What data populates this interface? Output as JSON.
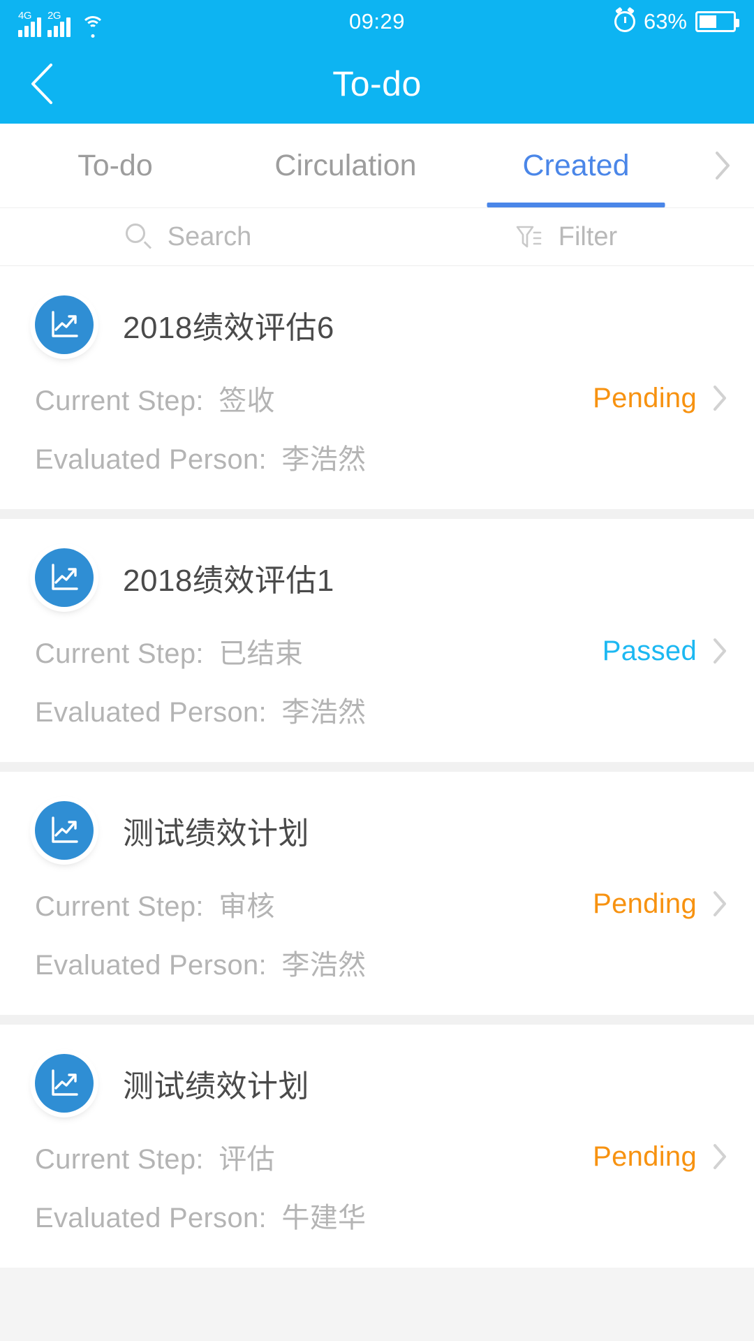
{
  "status_bar": {
    "network_primary": "4G",
    "network_secondary": "2G",
    "wifi_icon": "wifi-icon",
    "time": "09:29",
    "alarm_icon": "alarm-icon",
    "battery_percent": "63%",
    "battery_level": 52
  },
  "nav": {
    "back_icon": "chevron-left-icon",
    "title": "To-do"
  },
  "tabs": {
    "items": [
      {
        "label": "To-do",
        "active": false
      },
      {
        "label": "Circulation",
        "active": false
      },
      {
        "label": "Created",
        "active": true
      }
    ],
    "more_icon": "chevron-right-icon",
    "active_color": "#4a86e8",
    "inactive_color": "#9d9d9d"
  },
  "toolbar": {
    "search_label": "Search",
    "search_icon": "search-icon",
    "filter_label": "Filter",
    "filter_icon": "filter-icon"
  },
  "labels": {
    "current_step": "Current Step:",
    "evaluated_person": "Evaluated Person:"
  },
  "colors": {
    "header_blue": "#0db4f2",
    "avatar_blue": "#2f8ed4",
    "pending_orange": "#f79210",
    "passed_blue": "#1cb8f2",
    "meta_gray": "#b4b4b4",
    "title_gray": "#4a4a4a"
  },
  "list": {
    "items": [
      {
        "icon": "chart-trend-up-icon",
        "title": "2018绩效评估6",
        "current_step": "签收",
        "evaluated_person": "李浩然",
        "status": "Pending",
        "status_type": "pending",
        "chevron_icon": "chevron-right-icon"
      },
      {
        "icon": "chart-trend-up-icon",
        "title": "2018绩效评估1",
        "current_step": "已结束",
        "evaluated_person": "李浩然",
        "status": "Passed",
        "status_type": "passed",
        "chevron_icon": "chevron-right-icon"
      },
      {
        "icon": "chart-trend-up-icon",
        "title": "测试绩效计划",
        "current_step": "审核",
        "evaluated_person": "李浩然",
        "status": "Pending",
        "status_type": "pending",
        "chevron_icon": "chevron-right-icon"
      },
      {
        "icon": "chart-trend-up-icon",
        "title": "测试绩效计划",
        "current_step": "评估",
        "evaluated_person": "牛建华",
        "status": "Pending",
        "status_type": "pending",
        "chevron_icon": "chevron-right-icon"
      }
    ]
  }
}
